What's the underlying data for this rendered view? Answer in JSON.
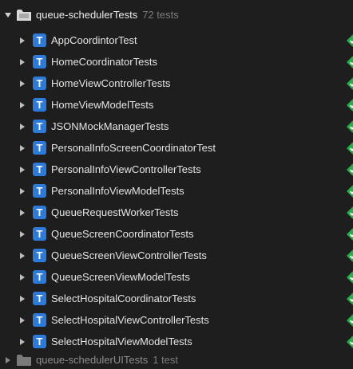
{
  "navigator": {
    "bundles": [
      {
        "name": "queue-schedulerTests",
        "count_label": "72 tests",
        "expanded": true,
        "classes": [
          {
            "name": "AppCoordintorTest"
          },
          {
            "name": "HomeCoordinatorTests"
          },
          {
            "name": "HomeViewControllerTests"
          },
          {
            "name": "HomeViewModelTests"
          },
          {
            "name": "JSONMockManagerTests"
          },
          {
            "name": "PersonalInfoScreenCoordinatorTest"
          },
          {
            "name": "PersonalInfoViewControllerTests"
          },
          {
            "name": "PersonalInfoViewModelTests"
          },
          {
            "name": "QueueRequestWorkerTests"
          },
          {
            "name": "QueueScreenCoordinatorTests"
          },
          {
            "name": "QueueScreenViewControllerTests"
          },
          {
            "name": "QueueScreenViewModelTests"
          },
          {
            "name": "SelectHospitalCoordinatorTests"
          },
          {
            "name": "SelectHospitalViewControllerTests"
          },
          {
            "name": "SelectHospitalViewModelTests"
          }
        ]
      },
      {
        "name": "queue-schedulerUITests",
        "count_label": "1 test",
        "expanded": false,
        "classes": []
      }
    ],
    "class_badge_letter": "T",
    "status": "passed",
    "colors": {
      "background": "#1e1e1e",
      "badge": "#2e7ad8",
      "passed": "#27ae4a",
      "folder": "#d9d9d9",
      "folder_dim": "#7a7a7a"
    },
    "icons": {
      "expanded": "disclosure-triangle-down-icon",
      "collapsed": "disclosure-triangle-right-icon",
      "bundle": "test-bundle-folder-icon",
      "passed": "test-passed-diamond-icon"
    }
  }
}
